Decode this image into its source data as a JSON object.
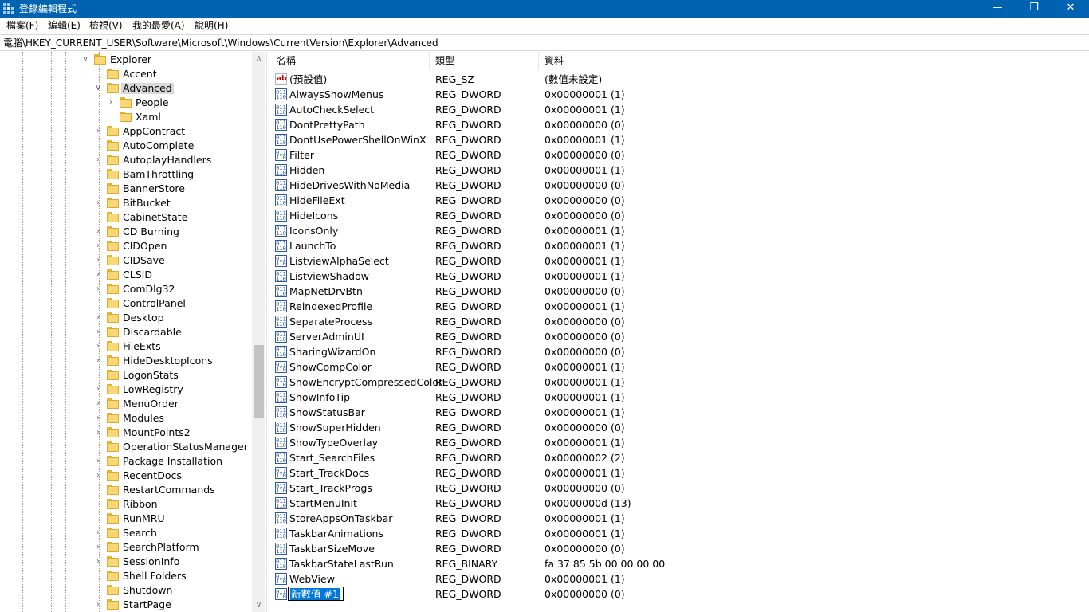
{
  "window": {
    "title": "登錄編輯程式",
    "minimize_glyph": "—",
    "maximize_glyph": "❐",
    "close_glyph": "✕",
    "app_icon": "regedit-icon"
  },
  "menu": [
    "檔案(F)",
    "編輯(E)",
    "檢視(V)",
    "我的最愛(A)",
    "說明(H)"
  ],
  "address": "電腦\\HKEY_CURRENT_USER\\Software\\Microsoft\\Windows\\CurrentVersion\\Explorer\\Advanced",
  "tree": {
    "expanded_glyph": "∨",
    "collapsed_glyph": "›",
    "items": [
      {
        "label": "Explorer",
        "level": 0,
        "state": "expanded"
      },
      {
        "label": "Accent",
        "level": 1,
        "state": "none"
      },
      {
        "label": "Advanced",
        "level": 1,
        "state": "expanded",
        "selected": true
      },
      {
        "label": "People",
        "level": 2,
        "state": "collapsed"
      },
      {
        "label": "Xaml",
        "level": 2,
        "state": "none"
      },
      {
        "label": "AppContract",
        "level": 1,
        "state": "collapsed"
      },
      {
        "label": "AutoComplete",
        "level": 1,
        "state": "none"
      },
      {
        "label": "AutoplayHandlers",
        "level": 1,
        "state": "collapsed"
      },
      {
        "label": "BamThrottling",
        "level": 1,
        "state": "none"
      },
      {
        "label": "BannerStore",
        "level": 1,
        "state": "none"
      },
      {
        "label": "BitBucket",
        "level": 1,
        "state": "collapsed"
      },
      {
        "label": "CabinetState",
        "level": 1,
        "state": "none"
      },
      {
        "label": "CD Burning",
        "level": 1,
        "state": "collapsed"
      },
      {
        "label": "CIDOpen",
        "level": 1,
        "state": "collapsed"
      },
      {
        "label": "CIDSave",
        "level": 1,
        "state": "collapsed"
      },
      {
        "label": "CLSID",
        "level": 1,
        "state": "collapsed"
      },
      {
        "label": "ComDlg32",
        "level": 1,
        "state": "collapsed"
      },
      {
        "label": "ControlPanel",
        "level": 1,
        "state": "none"
      },
      {
        "label": "Desktop",
        "level": 1,
        "state": "collapsed"
      },
      {
        "label": "Discardable",
        "level": 1,
        "state": "collapsed"
      },
      {
        "label": "FileExts",
        "level": 1,
        "state": "collapsed"
      },
      {
        "label": "HideDesktopIcons",
        "level": 1,
        "state": "collapsed"
      },
      {
        "label": "LogonStats",
        "level": 1,
        "state": "none"
      },
      {
        "label": "LowRegistry",
        "level": 1,
        "state": "collapsed"
      },
      {
        "label": "MenuOrder",
        "level": 1,
        "state": "collapsed"
      },
      {
        "label": "Modules",
        "level": 1,
        "state": "collapsed"
      },
      {
        "label": "MountPoints2",
        "level": 1,
        "state": "collapsed"
      },
      {
        "label": "OperationStatusManager",
        "level": 1,
        "state": "none"
      },
      {
        "label": "Package Installation",
        "level": 1,
        "state": "collapsed"
      },
      {
        "label": "RecentDocs",
        "level": 1,
        "state": "collapsed"
      },
      {
        "label": "RestartCommands",
        "level": 1,
        "state": "none"
      },
      {
        "label": "Ribbon",
        "level": 1,
        "state": "none"
      },
      {
        "label": "RunMRU",
        "level": 1,
        "state": "none"
      },
      {
        "label": "Search",
        "level": 1,
        "state": "collapsed"
      },
      {
        "label": "SearchPlatform",
        "level": 1,
        "state": "collapsed"
      },
      {
        "label": "SessionInfo",
        "level": 1,
        "state": "collapsed"
      },
      {
        "label": "Shell Folders",
        "level": 1,
        "state": "none"
      },
      {
        "label": "Shutdown",
        "level": 1,
        "state": "none"
      },
      {
        "label": "StartPage",
        "level": 1,
        "state": "collapsed"
      }
    ]
  },
  "scrollbar": {
    "up_glyph": "∧",
    "down_glyph": "∨"
  },
  "columns": [
    "名稱",
    "類型",
    "資料"
  ],
  "values": [
    {
      "name": "(預設值)",
      "type": "REG_SZ",
      "data": "(數值未設定)",
      "icon": "string-value-icon"
    },
    {
      "name": "AlwaysShowMenus",
      "type": "REG_DWORD",
      "data": "0x00000001 (1)",
      "icon": "binary-value-icon"
    },
    {
      "name": "AutoCheckSelect",
      "type": "REG_DWORD",
      "data": "0x00000001 (1)",
      "icon": "binary-value-icon"
    },
    {
      "name": "DontPrettyPath",
      "type": "REG_DWORD",
      "data": "0x00000000 (0)",
      "icon": "binary-value-icon"
    },
    {
      "name": "DontUsePowerShellOnWinX",
      "type": "REG_DWORD",
      "data": "0x00000001 (1)",
      "icon": "binary-value-icon"
    },
    {
      "name": "Filter",
      "type": "REG_DWORD",
      "data": "0x00000000 (0)",
      "icon": "binary-value-icon"
    },
    {
      "name": "Hidden",
      "type": "REG_DWORD",
      "data": "0x00000001 (1)",
      "icon": "binary-value-icon"
    },
    {
      "name": "HideDrivesWithNoMedia",
      "type": "REG_DWORD",
      "data": "0x00000000 (0)",
      "icon": "binary-value-icon"
    },
    {
      "name": "HideFileExt",
      "type": "REG_DWORD",
      "data": "0x00000000 (0)",
      "icon": "binary-value-icon"
    },
    {
      "name": "HideIcons",
      "type": "REG_DWORD",
      "data": "0x00000000 (0)",
      "icon": "binary-value-icon"
    },
    {
      "name": "IconsOnly",
      "type": "REG_DWORD",
      "data": "0x00000001 (1)",
      "icon": "binary-value-icon"
    },
    {
      "name": "LaunchTo",
      "type": "REG_DWORD",
      "data": "0x00000001 (1)",
      "icon": "binary-value-icon"
    },
    {
      "name": "ListviewAlphaSelect",
      "type": "REG_DWORD",
      "data": "0x00000001 (1)",
      "icon": "binary-value-icon"
    },
    {
      "name": "ListviewShadow",
      "type": "REG_DWORD",
      "data": "0x00000001 (1)",
      "icon": "binary-value-icon"
    },
    {
      "name": "MapNetDrvBtn",
      "type": "REG_DWORD",
      "data": "0x00000000 (0)",
      "icon": "binary-value-icon"
    },
    {
      "name": "ReindexedProfile",
      "type": "REG_DWORD",
      "data": "0x00000001 (1)",
      "icon": "binary-value-icon"
    },
    {
      "name": "SeparateProcess",
      "type": "REG_DWORD",
      "data": "0x00000000 (0)",
      "icon": "binary-value-icon"
    },
    {
      "name": "ServerAdminUI",
      "type": "REG_DWORD",
      "data": "0x00000000 (0)",
      "icon": "binary-value-icon"
    },
    {
      "name": "SharingWizardOn",
      "type": "REG_DWORD",
      "data": "0x00000000 (0)",
      "icon": "binary-value-icon"
    },
    {
      "name": "ShowCompColor",
      "type": "REG_DWORD",
      "data": "0x00000001 (1)",
      "icon": "binary-value-icon"
    },
    {
      "name": "ShowEncryptCompressedColor",
      "type": "REG_DWORD",
      "data": "0x00000001 (1)",
      "icon": "binary-value-icon"
    },
    {
      "name": "ShowInfoTip",
      "type": "REG_DWORD",
      "data": "0x00000001 (1)",
      "icon": "binary-value-icon"
    },
    {
      "name": "ShowStatusBar",
      "type": "REG_DWORD",
      "data": "0x00000001 (1)",
      "icon": "binary-value-icon"
    },
    {
      "name": "ShowSuperHidden",
      "type": "REG_DWORD",
      "data": "0x00000000 (0)",
      "icon": "binary-value-icon"
    },
    {
      "name": "ShowTypeOverlay",
      "type": "REG_DWORD",
      "data": "0x00000001 (1)",
      "icon": "binary-value-icon"
    },
    {
      "name": "Start_SearchFiles",
      "type": "REG_DWORD",
      "data": "0x00000002 (2)",
      "icon": "binary-value-icon"
    },
    {
      "name": "Start_TrackDocs",
      "type": "REG_DWORD",
      "data": "0x00000001 (1)",
      "icon": "binary-value-icon"
    },
    {
      "name": "Start_TrackProgs",
      "type": "REG_DWORD",
      "data": "0x00000000 (0)",
      "icon": "binary-value-icon"
    },
    {
      "name": "StartMenuInit",
      "type": "REG_DWORD",
      "data": "0x0000000d (13)",
      "icon": "binary-value-icon"
    },
    {
      "name": "StoreAppsOnTaskbar",
      "type": "REG_DWORD",
      "data": "0x00000001 (1)",
      "icon": "binary-value-icon"
    },
    {
      "name": "TaskbarAnimations",
      "type": "REG_DWORD",
      "data": "0x00000001 (1)",
      "icon": "binary-value-icon"
    },
    {
      "name": "TaskbarSizeMove",
      "type": "REG_DWORD",
      "data": "0x00000000 (0)",
      "icon": "binary-value-icon"
    },
    {
      "name": "TaskbarStateLastRun",
      "type": "REG_BINARY",
      "data": "fa 37 85 5b 00 00 00 00",
      "icon": "binary-value-icon"
    },
    {
      "name": "WebView",
      "type": "REG_DWORD",
      "data": "0x00000001 (1)",
      "icon": "binary-value-icon"
    },
    {
      "name": "新數值 #1",
      "type": "REG_DWORD",
      "data": "0x00000000 (0)",
      "icon": "binary-value-icon",
      "editing": true
    }
  ],
  "colors": {
    "titlebar": "#0063b1",
    "selection": "#0078d7",
    "folder": "#f8d775"
  }
}
